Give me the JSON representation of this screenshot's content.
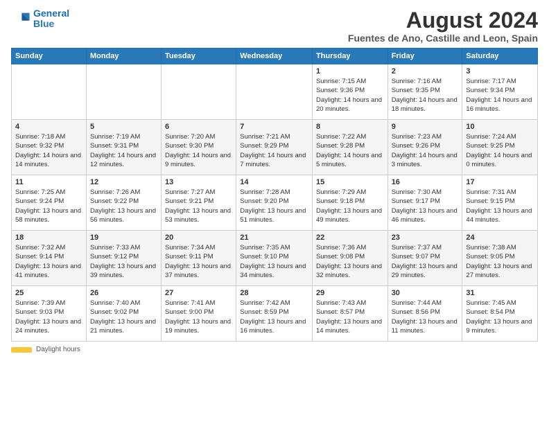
{
  "logo": {
    "line1": "General",
    "line2": "Blue"
  },
  "title": "August 2024",
  "subtitle": "Fuentes de Ano, Castille and Leon, Spain",
  "weekdays": [
    "Sunday",
    "Monday",
    "Tuesday",
    "Wednesday",
    "Thursday",
    "Friday",
    "Saturday"
  ],
  "weeks": [
    [
      {
        "day": "",
        "info": ""
      },
      {
        "day": "",
        "info": ""
      },
      {
        "day": "",
        "info": ""
      },
      {
        "day": "",
        "info": ""
      },
      {
        "day": "1",
        "info": "Sunrise: 7:15 AM\nSunset: 9:36 PM\nDaylight: 14 hours and 20 minutes."
      },
      {
        "day": "2",
        "info": "Sunrise: 7:16 AM\nSunset: 9:35 PM\nDaylight: 14 hours and 18 minutes."
      },
      {
        "day": "3",
        "info": "Sunrise: 7:17 AM\nSunset: 9:34 PM\nDaylight: 14 hours and 16 minutes."
      }
    ],
    [
      {
        "day": "4",
        "info": "Sunrise: 7:18 AM\nSunset: 9:32 PM\nDaylight: 14 hours and 14 minutes."
      },
      {
        "day": "5",
        "info": "Sunrise: 7:19 AM\nSunset: 9:31 PM\nDaylight: 14 hours and 12 minutes."
      },
      {
        "day": "6",
        "info": "Sunrise: 7:20 AM\nSunset: 9:30 PM\nDaylight: 14 hours and 9 minutes."
      },
      {
        "day": "7",
        "info": "Sunrise: 7:21 AM\nSunset: 9:29 PM\nDaylight: 14 hours and 7 minutes."
      },
      {
        "day": "8",
        "info": "Sunrise: 7:22 AM\nSunset: 9:28 PM\nDaylight: 14 hours and 5 minutes."
      },
      {
        "day": "9",
        "info": "Sunrise: 7:23 AM\nSunset: 9:26 PM\nDaylight: 14 hours and 3 minutes."
      },
      {
        "day": "10",
        "info": "Sunrise: 7:24 AM\nSunset: 9:25 PM\nDaylight: 14 hours and 0 minutes."
      }
    ],
    [
      {
        "day": "11",
        "info": "Sunrise: 7:25 AM\nSunset: 9:24 PM\nDaylight: 13 hours and 58 minutes."
      },
      {
        "day": "12",
        "info": "Sunrise: 7:26 AM\nSunset: 9:22 PM\nDaylight: 13 hours and 56 minutes."
      },
      {
        "day": "13",
        "info": "Sunrise: 7:27 AM\nSunset: 9:21 PM\nDaylight: 13 hours and 53 minutes."
      },
      {
        "day": "14",
        "info": "Sunrise: 7:28 AM\nSunset: 9:20 PM\nDaylight: 13 hours and 51 minutes."
      },
      {
        "day": "15",
        "info": "Sunrise: 7:29 AM\nSunset: 9:18 PM\nDaylight: 13 hours and 49 minutes."
      },
      {
        "day": "16",
        "info": "Sunrise: 7:30 AM\nSunset: 9:17 PM\nDaylight: 13 hours and 46 minutes."
      },
      {
        "day": "17",
        "info": "Sunrise: 7:31 AM\nSunset: 9:15 PM\nDaylight: 13 hours and 44 minutes."
      }
    ],
    [
      {
        "day": "18",
        "info": "Sunrise: 7:32 AM\nSunset: 9:14 PM\nDaylight: 13 hours and 41 minutes."
      },
      {
        "day": "19",
        "info": "Sunrise: 7:33 AM\nSunset: 9:12 PM\nDaylight: 13 hours and 39 minutes."
      },
      {
        "day": "20",
        "info": "Sunrise: 7:34 AM\nSunset: 9:11 PM\nDaylight: 13 hours and 37 minutes."
      },
      {
        "day": "21",
        "info": "Sunrise: 7:35 AM\nSunset: 9:10 PM\nDaylight: 13 hours and 34 minutes."
      },
      {
        "day": "22",
        "info": "Sunrise: 7:36 AM\nSunset: 9:08 PM\nDaylight: 13 hours and 32 minutes."
      },
      {
        "day": "23",
        "info": "Sunrise: 7:37 AM\nSunset: 9:07 PM\nDaylight: 13 hours and 29 minutes."
      },
      {
        "day": "24",
        "info": "Sunrise: 7:38 AM\nSunset: 9:05 PM\nDaylight: 13 hours and 27 minutes."
      }
    ],
    [
      {
        "day": "25",
        "info": "Sunrise: 7:39 AM\nSunset: 9:03 PM\nDaylight: 13 hours and 24 minutes."
      },
      {
        "day": "26",
        "info": "Sunrise: 7:40 AM\nSunset: 9:02 PM\nDaylight: 13 hours and 21 minutes."
      },
      {
        "day": "27",
        "info": "Sunrise: 7:41 AM\nSunset: 9:00 PM\nDaylight: 13 hours and 19 minutes."
      },
      {
        "day": "28",
        "info": "Sunrise: 7:42 AM\nSunset: 8:59 PM\nDaylight: 13 hours and 16 minutes."
      },
      {
        "day": "29",
        "info": "Sunrise: 7:43 AM\nSunset: 8:57 PM\nDaylight: 13 hours and 14 minutes."
      },
      {
        "day": "30",
        "info": "Sunrise: 7:44 AM\nSunset: 8:56 PM\nDaylight: 13 hours and 11 minutes."
      },
      {
        "day": "31",
        "info": "Sunrise: 7:45 AM\nSunset: 8:54 PM\nDaylight: 13 hours and 9 minutes."
      }
    ]
  ],
  "footer": {
    "daylight_label": "Daylight hours",
    "url": "www.generalblue.com"
  },
  "colors": {
    "header_bg": "#2979b8",
    "header_text": "#ffffff",
    "accent": "#1a6eb5"
  }
}
